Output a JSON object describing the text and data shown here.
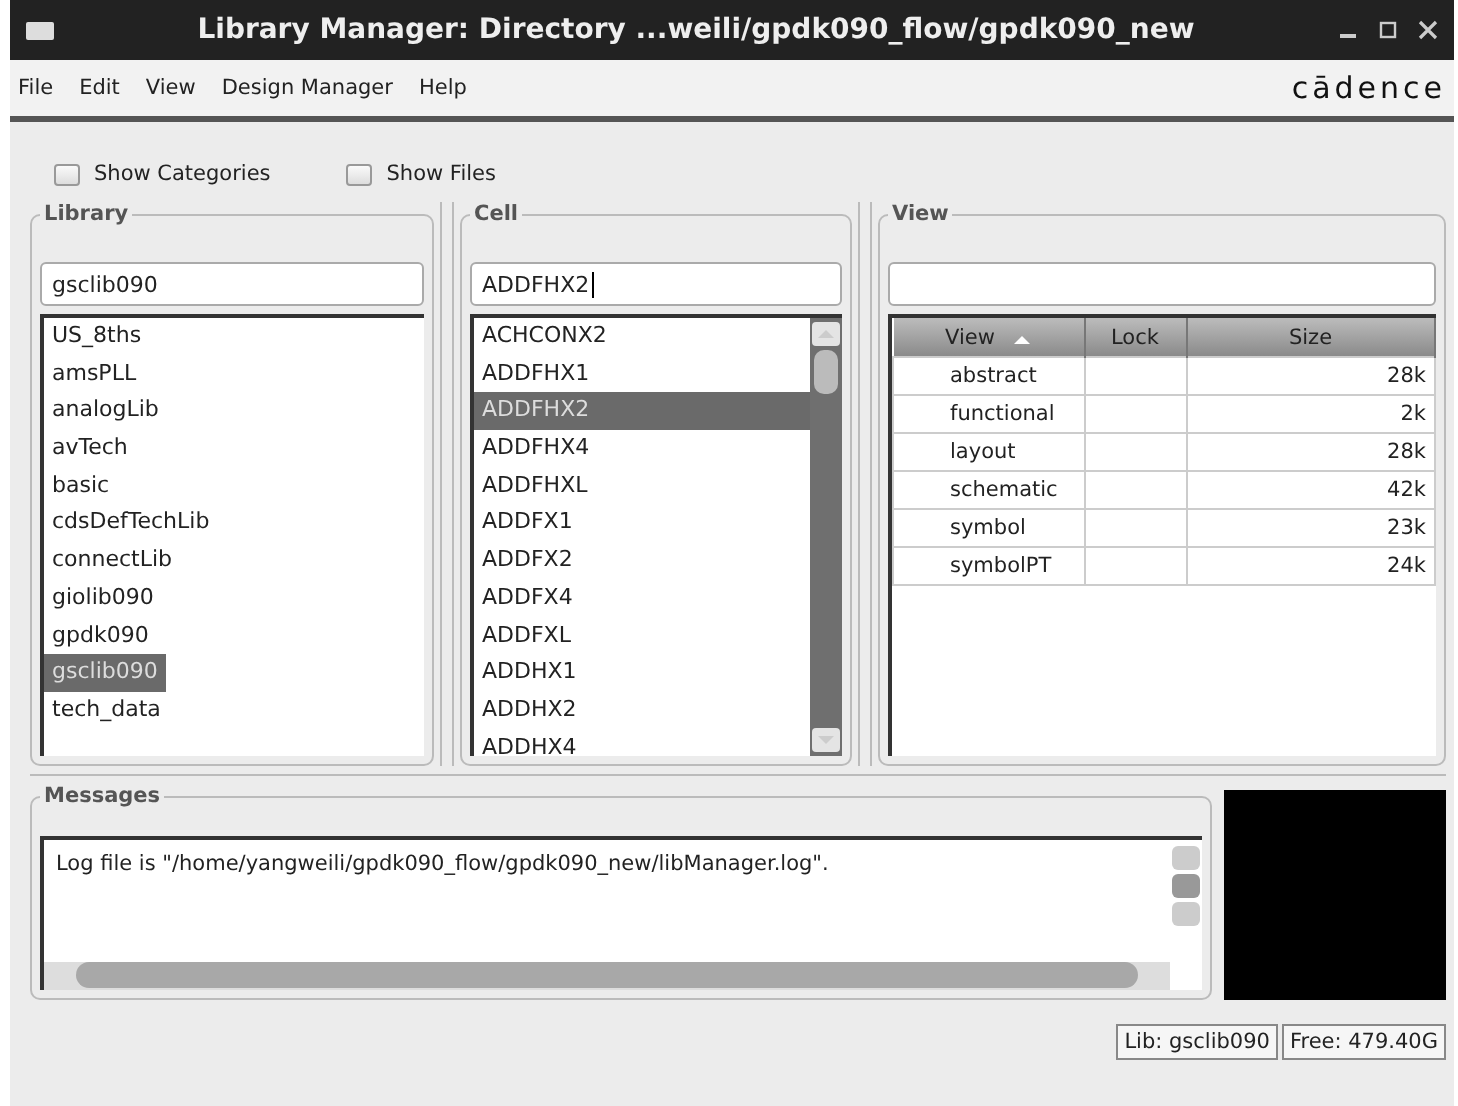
{
  "window": {
    "title": "Library Manager: Directory ...weili/gpdk090_flow/gpdk090_new"
  },
  "menu": [
    "File",
    "Edit",
    "View",
    "Design Manager",
    "Help"
  ],
  "logo": "cādence",
  "options": [
    {
      "label": "Show Categories",
      "checked": false
    },
    {
      "label": "Show Files",
      "checked": false
    }
  ],
  "library": {
    "title": "Library",
    "value": "gsclib090",
    "items": [
      {
        "label": "US_8ths",
        "selected": false
      },
      {
        "label": "amsPLL",
        "selected": false
      },
      {
        "label": "analogLib",
        "selected": false
      },
      {
        "label": "avTech",
        "selected": false
      },
      {
        "label": "basic",
        "selected": false
      },
      {
        "label": "cdsDefTechLib",
        "selected": false
      },
      {
        "label": "connectLib",
        "selected": false
      },
      {
        "label": "giolib090",
        "selected": false
      },
      {
        "label": "gpdk090",
        "selected": false
      },
      {
        "label": "gsclib090",
        "selected": true
      },
      {
        "label": "tech_data",
        "selected": false
      }
    ]
  },
  "cell": {
    "title": "Cell",
    "value": "ADDFHX2",
    "items": [
      {
        "label": "ACHCONX2",
        "selected": false
      },
      {
        "label": "ADDFHX1",
        "selected": false
      },
      {
        "label": "ADDFHX2",
        "selected": true
      },
      {
        "label": "ADDFHX4",
        "selected": false
      },
      {
        "label": "ADDFHXL",
        "selected": false
      },
      {
        "label": "ADDFX1",
        "selected": false
      },
      {
        "label": "ADDFX2",
        "selected": false
      },
      {
        "label": "ADDFX4",
        "selected": false
      },
      {
        "label": "ADDFXL",
        "selected": false
      },
      {
        "label": "ADDHX1",
        "selected": false
      },
      {
        "label": "ADDHX2",
        "selected": false
      },
      {
        "label": "ADDHX4",
        "selected": false
      }
    ]
  },
  "view": {
    "title": "View",
    "columns": [
      {
        "label": "View",
        "sorted": true
      },
      {
        "label": "Lock",
        "sorted": false
      },
      {
        "label": "Size",
        "sorted": false
      }
    ],
    "rows": [
      [
        "abstract",
        "",
        "28k"
      ],
      [
        "functional",
        "",
        "2k"
      ],
      [
        "layout",
        "",
        "28k"
      ],
      [
        "schematic",
        "",
        "42k"
      ],
      [
        "symbol",
        "",
        "23k"
      ],
      [
        "symbolPT",
        "",
        "24k"
      ]
    ]
  },
  "messages": {
    "title": "Messages",
    "text": "Log file is \"/home/yangweili/gpdk090_flow/gpdk090_new/libManager.log\"."
  },
  "status_bar": [
    "Lib: gsclib090",
    "Free: 479.40G"
  ]
}
